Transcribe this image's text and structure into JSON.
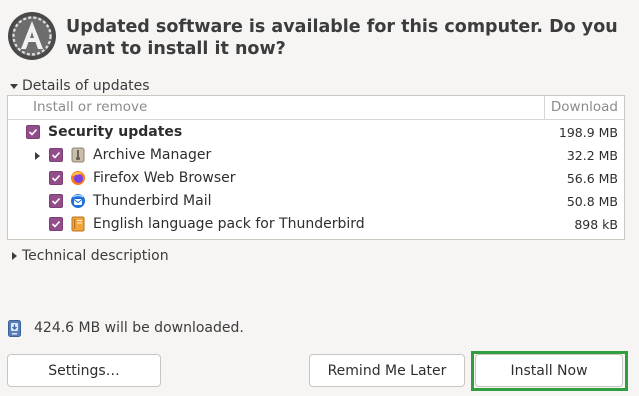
{
  "dialog": {
    "headline": "Updated software is available for this computer. Do you want to install it now?",
    "app_icon": "software-updater-icon"
  },
  "details": {
    "label": "Details of updates",
    "expanded": true,
    "columns": {
      "install": "Install or remove",
      "download": "Download"
    },
    "rows": [
      {
        "type": "group",
        "label": "Security updates",
        "size": "198.9 MB",
        "checked": true
      },
      {
        "type": "item",
        "label": "Archive Manager",
        "size": "32.2 MB",
        "checked": true,
        "icon": "archive-manager-icon",
        "has_children": true
      },
      {
        "type": "item",
        "label": "Firefox Web Browser",
        "size": "56.6 MB",
        "checked": true,
        "icon": "firefox-icon"
      },
      {
        "type": "item",
        "label": "Thunderbird Mail",
        "size": "50.8 MB",
        "checked": true,
        "icon": "thunderbird-icon"
      },
      {
        "type": "item",
        "label": "English language pack for Thunderbird",
        "size": "898 kB",
        "checked": true,
        "icon": "language-pack-icon"
      }
    ]
  },
  "technical": {
    "label": "Technical description",
    "expanded": false
  },
  "download_summary": {
    "text": "424.6 MB will be downloaded."
  },
  "buttons": {
    "settings": "Settings…",
    "remind": "Remind Me Later",
    "install": "Install Now"
  },
  "colors": {
    "checkbox": "#924d8b",
    "highlight": "#2e9e3e"
  }
}
